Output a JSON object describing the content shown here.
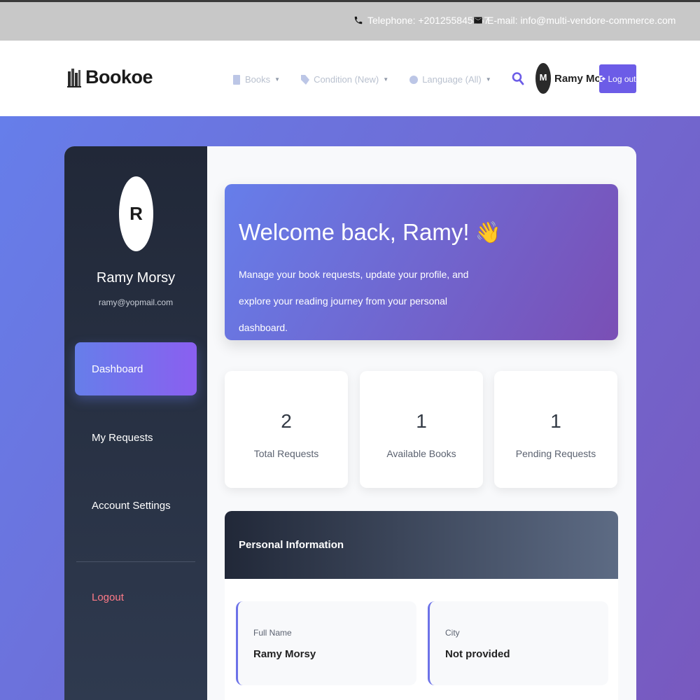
{
  "topbar": {
    "phone": "Telephone: +201255845857",
    "email": "E-mail: info@multi-vendore-commerce.com"
  },
  "header": {
    "brand": "Bookoe",
    "nav": [
      {
        "label": "Books",
        "icon": "book-icon"
      },
      {
        "label": "Condition (New)",
        "icon": "tag-icon"
      },
      {
        "label": "Language (All)",
        "icon": "globe-icon"
      }
    ],
    "user_initial": "M",
    "user_name": "Ramy Morsy",
    "logout_label": "Log out"
  },
  "sidebar": {
    "avatar_initial": "R",
    "name": "Ramy Morsy",
    "email": "ramy@yopmail.com",
    "items": [
      {
        "label": "Dashboard",
        "active": true
      },
      {
        "label": "My Requests"
      },
      {
        "label": "Account Settings"
      }
    ],
    "logout_label": "Logout"
  },
  "welcome": {
    "title": "Welcome back, Ramy!",
    "emoji": "👋",
    "text": "Manage your book requests, update your profile, and explore your reading journey from your personal dashboard."
  },
  "stats": [
    {
      "value": "2",
      "label": "Total Requests"
    },
    {
      "value": "1",
      "label": "Available Books"
    },
    {
      "value": "1",
      "label": "Pending Requests"
    }
  ],
  "personal_info": {
    "title": "Personal Information",
    "fields": [
      {
        "label": "Full Name",
        "value": "Ramy Morsy"
      },
      {
        "label": "City",
        "value": "Not provided"
      }
    ]
  },
  "colors": {
    "accent": "#6c5ce7",
    "gradient_start": "#667eea",
    "gradient_end": "#764ba2",
    "sidebar_dark": "#212838",
    "logout_red": "#ff7b88"
  }
}
